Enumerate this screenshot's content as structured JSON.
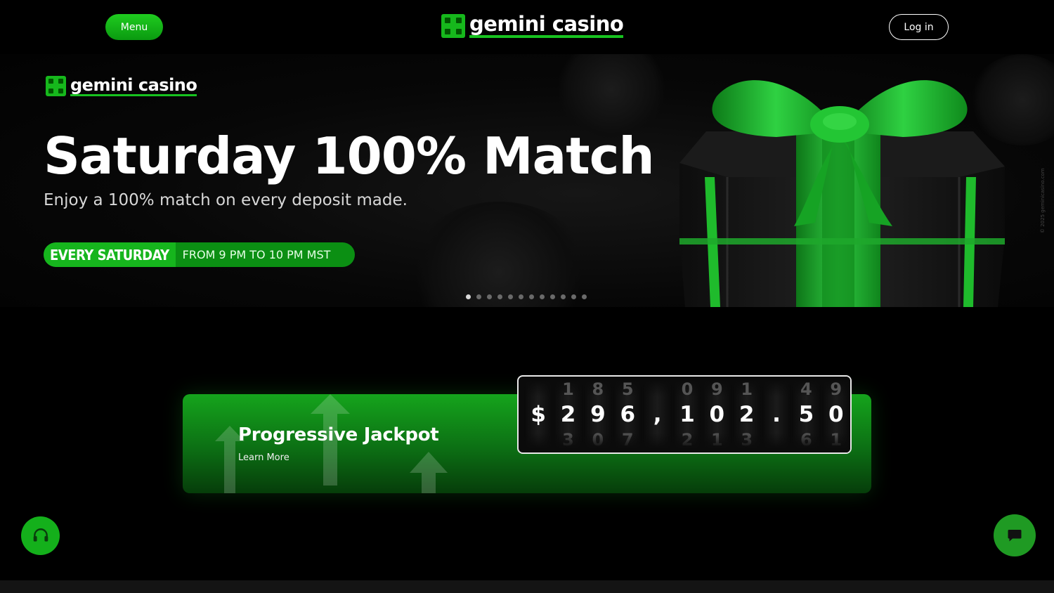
{
  "header": {
    "menu_label": "Menu",
    "login_label": "Log in",
    "brand_name": "gemini casino"
  },
  "hero": {
    "brand_name": "gemini casino",
    "title": "Saturday 100% Match",
    "subtitle": "Enjoy a 100% match on every deposit made.",
    "pill_strong": "EVERY SATURDAY",
    "pill_rest": "FROM 9 PM TO 10 PM MST",
    "slide_count": 12,
    "active_slide": 1,
    "copyright": "© 2025 geminicasino.com"
  },
  "jackpot": {
    "title": "Progressive Jackpot",
    "link_label": "Learn More",
    "amount": "$296,102.50",
    "digits": [
      {
        "prev": "",
        "value": "$",
        "next": ""
      },
      {
        "prev": "1",
        "value": "2",
        "next": "3"
      },
      {
        "prev": "8",
        "value": "9",
        "next": "0"
      },
      {
        "prev": "5",
        "value": "6",
        "next": "7"
      },
      {
        "prev": "",
        "value": ",",
        "next": ""
      },
      {
        "prev": "0",
        "value": "1",
        "next": "2"
      },
      {
        "prev": "9",
        "value": "0",
        "next": "1"
      },
      {
        "prev": "1",
        "value": "2",
        "next": "3"
      },
      {
        "prev": "",
        "value": ".",
        "next": ""
      },
      {
        "prev": "4",
        "value": "5",
        "next": "6"
      },
      {
        "prev": "9",
        "value": "0",
        "next": "1"
      }
    ]
  },
  "colors": {
    "accent": "#16b81c",
    "background": "#000000",
    "jackpot_top": "#15a41c",
    "jackpot_bottom": "#063d0a"
  },
  "icons": {
    "support": "headset-icon",
    "chat": "chat-bubble-icon"
  }
}
